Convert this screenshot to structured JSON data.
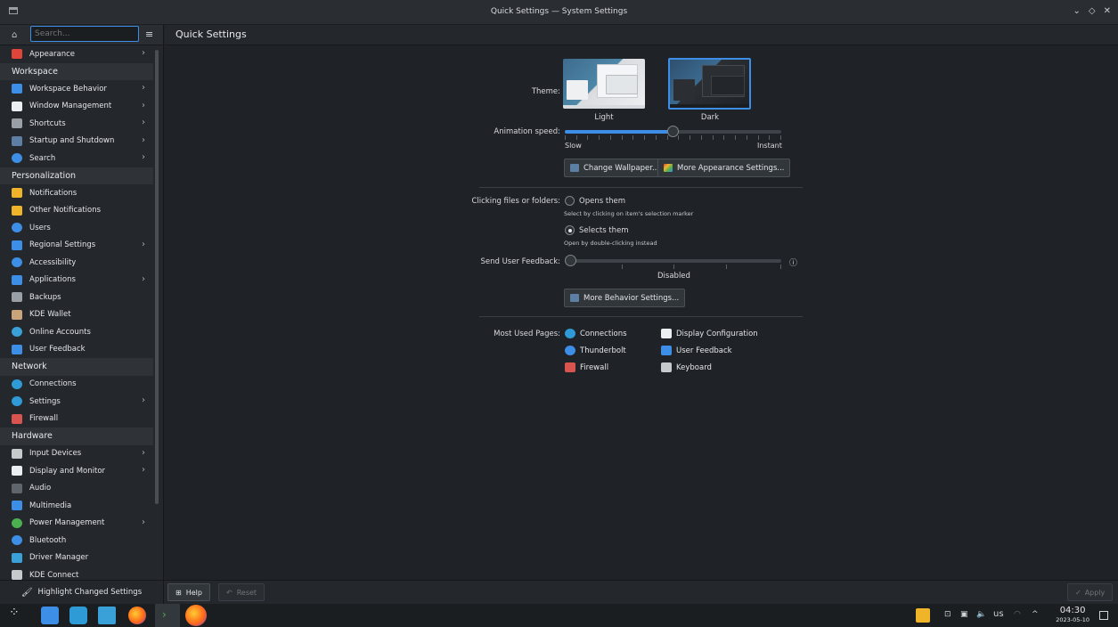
{
  "window": {
    "title": "Quick Settings — System Settings",
    "controls": [
      "⌄",
      "◇",
      "✕"
    ]
  },
  "sidebar": {
    "search_placeholder": "Search...",
    "items": [
      {
        "type": "item",
        "label": "Appearance",
        "icon": "appearance-icon",
        "color": "#e0453a",
        "chevron": true
      },
      {
        "type": "category",
        "label": "Workspace"
      },
      {
        "type": "item",
        "label": "Workspace Behavior",
        "icon": "workspace-behavior-icon",
        "color": "#3d8ee6",
        "chevron": true
      },
      {
        "type": "item",
        "label": "Window Management",
        "icon": "window-management-icon",
        "color": "#eceff1",
        "chevron": true
      },
      {
        "type": "item",
        "label": "Shortcuts",
        "icon": "shortcuts-icon",
        "color": "#9aa0a6",
        "chevron": true
      },
      {
        "type": "item",
        "label": "Startup and Shutdown",
        "icon": "startup-icon",
        "color": "#5d7fa3",
        "chevron": true
      },
      {
        "type": "item",
        "label": "Search",
        "icon": "search-icon",
        "color": "#3d8ee6",
        "chevron": true,
        "round": true
      },
      {
        "type": "category",
        "label": "Personalization"
      },
      {
        "type": "item",
        "label": "Notifications",
        "icon": "bell-icon",
        "color": "#f0b429",
        "chevron": false
      },
      {
        "type": "item",
        "label": "Other Notifications",
        "icon": "bell-icon",
        "color": "#f0b429",
        "chevron": false
      },
      {
        "type": "item",
        "label": "Users",
        "icon": "users-icon",
        "color": "#3d8ee6",
        "chevron": false,
        "round": true
      },
      {
        "type": "item",
        "label": "Regional Settings",
        "icon": "regional-icon",
        "color": "#3d8ee6",
        "chevron": true
      },
      {
        "type": "item",
        "label": "Accessibility",
        "icon": "accessibility-icon",
        "color": "#3d8ee6",
        "chevron": false,
        "round": true
      },
      {
        "type": "item",
        "label": "Applications",
        "icon": "applications-icon",
        "color": "#3d8ee6",
        "chevron": true
      },
      {
        "type": "item",
        "label": "Backups",
        "icon": "backups-icon",
        "color": "#9aa0a6",
        "chevron": false
      },
      {
        "type": "item",
        "label": "KDE Wallet",
        "icon": "wallet-icon",
        "color": "#c9a37a",
        "chevron": false
      },
      {
        "type": "item",
        "label": "Online Accounts",
        "icon": "online-accounts-icon",
        "color": "#3aa0d8",
        "chevron": false,
        "round": true
      },
      {
        "type": "item",
        "label": "User Feedback",
        "icon": "feedback-icon",
        "color": "#3d8ee6",
        "chevron": false
      },
      {
        "type": "category",
        "label": "Network"
      },
      {
        "type": "item",
        "label": "Connections",
        "icon": "globe-icon",
        "color": "#2f9bd6",
        "chevron": false,
        "round": true
      },
      {
        "type": "item",
        "label": "Settings",
        "icon": "globe-icon",
        "color": "#2f9bd6",
        "chevron": true,
        "round": true
      },
      {
        "type": "item",
        "label": "Firewall",
        "icon": "firewall-icon",
        "color": "#d9534f",
        "chevron": false
      },
      {
        "type": "category",
        "label": "Hardware"
      },
      {
        "type": "item",
        "label": "Input Devices",
        "icon": "input-devices-icon",
        "color": "#c7cacd",
        "chevron": true
      },
      {
        "type": "item",
        "label": "Display and Monitor",
        "icon": "display-icon",
        "color": "#eceff1",
        "chevron": true
      },
      {
        "type": "item",
        "label": "Audio",
        "icon": "audio-icon",
        "color": "#5f656b",
        "chevron": false
      },
      {
        "type": "item",
        "label": "Multimedia",
        "icon": "multimedia-icon",
        "color": "#3d8ee6",
        "chevron": false
      },
      {
        "type": "item",
        "label": "Power Management",
        "icon": "power-icon",
        "color": "#4caf50",
        "chevron": true,
        "round": true
      },
      {
        "type": "item",
        "label": "Bluetooth",
        "icon": "bluetooth-icon",
        "color": "#3d8ee6",
        "chevron": false,
        "round": true
      },
      {
        "type": "item",
        "label": "Driver Manager",
        "icon": "driver-icon",
        "color": "#3aa0d8",
        "chevron": false
      },
      {
        "type": "item",
        "label": "KDE Connect",
        "icon": "kde-connect-icon",
        "color": "#c7cacd",
        "chevron": false
      }
    ]
  },
  "main": {
    "page_title": "Quick Settings",
    "theme": {
      "label": "Theme:",
      "light": "Light",
      "dark": "Dark",
      "selected": "Dark"
    },
    "animation": {
      "label": "Animation speed:",
      "min_label": "Slow",
      "max_label": "Instant",
      "value_fraction": 0.5
    },
    "buttons": {
      "change_wallpaper": "Change Wallpaper...",
      "more_appearance": "More Appearance Settings..."
    },
    "clicking": {
      "label": "Clicking files or folders:",
      "opens": "Opens them",
      "opens_hint": "Select by clicking on item's selection marker",
      "selects": "Selects them",
      "selects_hint": "Open by double-clicking instead",
      "selected": "Selects them"
    },
    "feedback": {
      "label": "Send User Feedback:",
      "value": "Disabled",
      "value_fraction": 0.0
    },
    "more_behavior": "More Behavior Settings...",
    "most_used": {
      "label": "Most Used Pages:",
      "pages": [
        {
          "label": "Connections",
          "icon": "globe-icon",
          "color": "#2f9bd6"
        },
        {
          "label": "Display Configuration",
          "icon": "display-icon",
          "color": "#eceff1"
        },
        {
          "label": "Thunderbolt",
          "icon": "thunderbolt-icon",
          "color": "#3d8ee6"
        },
        {
          "label": "User Feedback",
          "icon": "feedback-icon",
          "color": "#3d8ee6"
        },
        {
          "label": "Firewall",
          "icon": "firewall-icon",
          "color": "#d9534f"
        },
        {
          "label": "Keyboard",
          "icon": "keyboard-icon",
          "color": "#c7cacd"
        }
      ]
    }
  },
  "bottom": {
    "highlight": "Highlight Changed Settings",
    "help": "Help",
    "reset": "Reset",
    "apply": "Apply"
  },
  "taskbar": {
    "keyboard_layout": "us",
    "time": "04:30",
    "date": "2023-05-10"
  }
}
